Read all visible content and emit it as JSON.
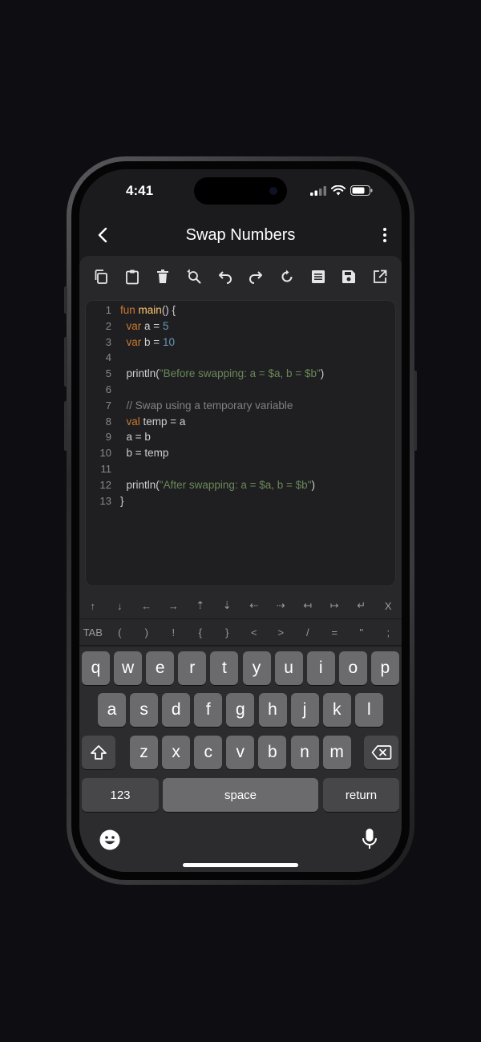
{
  "status": {
    "time": "4:41"
  },
  "header": {
    "title": "Swap Numbers"
  },
  "toolbar": {
    "icons": [
      "copy-icon",
      "paste-icon",
      "delete-icon",
      "find-replace-icon",
      "undo-icon",
      "redo-icon",
      "refresh-icon",
      "format-icon",
      "save-icon",
      "open-external-icon"
    ]
  },
  "editor": {
    "lines": [
      {
        "n": "1",
        "t": "fun main() {"
      },
      {
        "n": "2",
        "t": "  var a = 5"
      },
      {
        "n": "3",
        "t": "  var b = 10"
      },
      {
        "n": "4",
        "t": ""
      },
      {
        "n": "5",
        "t": "  println(\"Before swapping: a = $a, b = $b\")"
      },
      {
        "n": "6",
        "t": ""
      },
      {
        "n": "7",
        "t": "  // Swap using a temporary variable"
      },
      {
        "n": "8",
        "t": "  val temp = a"
      },
      {
        "n": "9",
        "t": "  a = b"
      },
      {
        "n": "10",
        "t": "  b = temp"
      },
      {
        "n": "11",
        "t": ""
      },
      {
        "n": "12",
        "t": "  println(\"After swapping: a = $a, b = $b\")"
      },
      {
        "n": "13",
        "t": "}"
      }
    ]
  },
  "symbols": {
    "row1": [
      "↑",
      "↓",
      "←",
      "→",
      "⇡",
      "⇣",
      "⇠",
      "⇢",
      "↤",
      "↦",
      "↵",
      "X"
    ],
    "row2": [
      "TAB",
      "(",
      ")",
      "!",
      "{",
      "}",
      "<",
      ">",
      "/",
      "=",
      "\"",
      ";"
    ]
  },
  "keyboard": {
    "row1": [
      "q",
      "w",
      "e",
      "r",
      "t",
      "y",
      "u",
      "i",
      "o",
      "p"
    ],
    "row2": [
      "a",
      "s",
      "d",
      "f",
      "g",
      "h",
      "j",
      "k",
      "l"
    ],
    "row3": [
      "z",
      "x",
      "c",
      "v",
      "b",
      "n",
      "m"
    ],
    "numbers_label": "123",
    "space_label": "space",
    "return_label": "return"
  },
  "colors": {
    "accent": "#5b3ea8",
    "keyword": "#cc7832",
    "function": "#ffc66d",
    "number": "#6897bb",
    "string": "#6a8759",
    "comment": "#808080"
  }
}
